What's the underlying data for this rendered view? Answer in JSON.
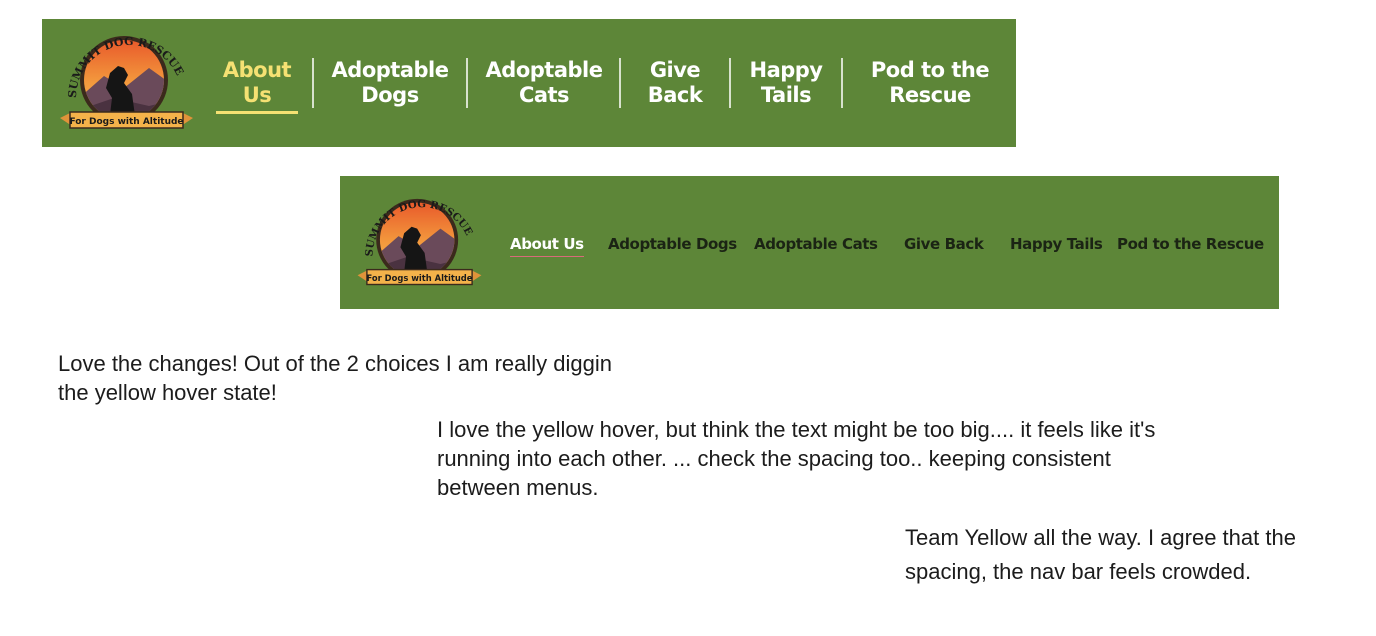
{
  "logo": {
    "arc_text": "SUMMIT DOG RESCUE",
    "banner_text": "For Dogs with Altitude"
  },
  "nav_option_1": {
    "items": [
      {
        "line1": "About",
        "line2": "Us",
        "active": true
      },
      {
        "line1": "Adoptable",
        "line2": "Dogs"
      },
      {
        "line1": "Adoptable",
        "line2": "Cats"
      },
      {
        "line1": "Give",
        "line2": "Back"
      },
      {
        "line1": "Happy",
        "line2": "Tails"
      },
      {
        "line1": "Pod to the",
        "line2": "Rescue"
      }
    ],
    "active_color": "#f5e173"
  },
  "nav_option_2": {
    "items": [
      {
        "label": "About Us",
        "active": true
      },
      {
        "label": "Adoptable Dogs"
      },
      {
        "label": "Adoptable Cats"
      },
      {
        "label": "Give Back"
      },
      {
        "label": "Happy Tails"
      },
      {
        "label": "Pod to the Rescue"
      }
    ]
  },
  "colors": {
    "nav_bg": "#5d8638",
    "hover_yellow": "#f5e173"
  },
  "comments": [
    {
      "text": "Love the changes! Out of the 2 choices I am really diggin the yellow hover state!"
    },
    {
      "text": "I love the yellow hover, but think the text might be too big.... it feels like it's running into each other. ... check the spacing too.. keeping consistent between menus."
    },
    {
      "text": "Team Yellow all the way. I agree that the spacing, the nav bar feels crowded."
    }
  ]
}
